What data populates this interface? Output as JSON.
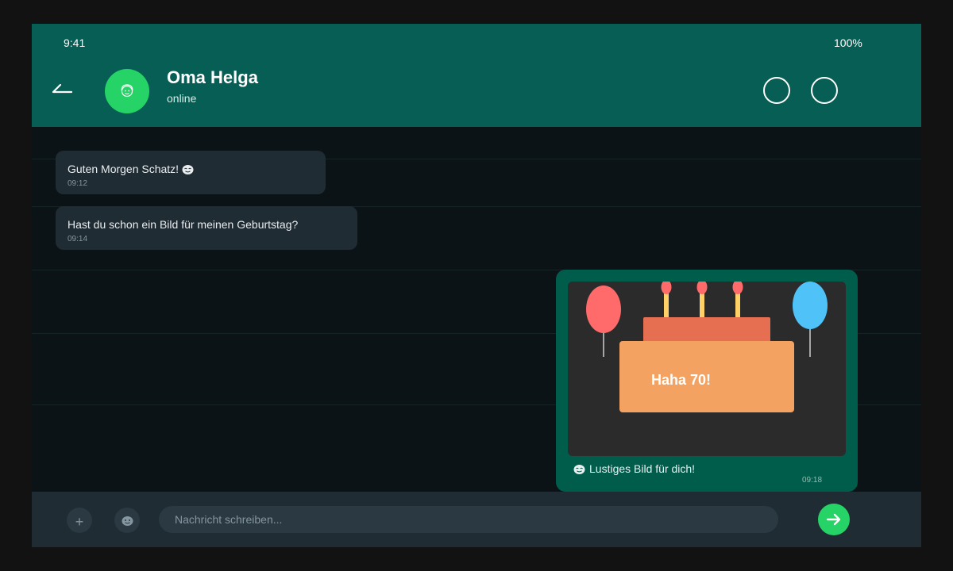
{
  "status_bar": {
    "time": "9:41",
    "battery": "100%"
  },
  "header": {
    "contact_name": "Oma Helga",
    "contact_status": "online",
    "back_icon": "back-arrow-icon",
    "action_icons": [
      "call-icon",
      "menu-icon"
    ]
  },
  "messages": [
    {
      "direction": "in",
      "text": "Guten Morgen Schatz!",
      "emoji": "smile-emoji",
      "time": "09:12"
    },
    {
      "direction": "in",
      "text": "Hast du schon ein Bild für meinen Geburtstag?",
      "time": "09:14"
    },
    {
      "direction": "out",
      "image": {
        "cake_text": "Haha 70!",
        "candles": 3,
        "balloons": [
          {
            "color": "#ff6b6b"
          },
          {
            "color": "#4fc3f7"
          }
        ]
      },
      "caption": "Lustiges Bild für dich!",
      "caption_emoji": "smile-emoji",
      "time": "09:18"
    }
  ],
  "input_bar": {
    "attach_icon": "plus-icon",
    "emoji_icon": "emoji-icon",
    "placeholder": "Nachricht schreiben...",
    "send_icon": "send-arrow-icon"
  },
  "colors": {
    "header": "#075e54",
    "chat_background": "#0c1316",
    "incoming_bubble": "#202c33",
    "outgoing_bubble": "#005c4b",
    "accent_green": "#25d366",
    "cake": "#f4a261",
    "cake_top": "#e76f51"
  }
}
